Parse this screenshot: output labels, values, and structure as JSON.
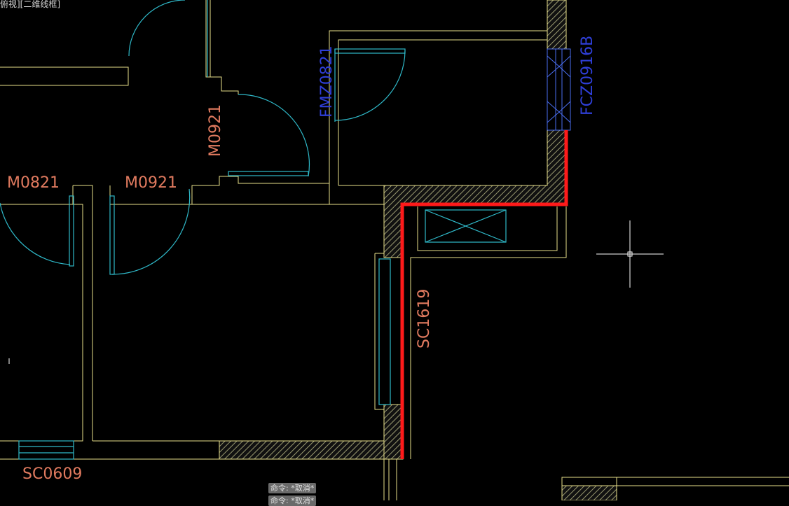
{
  "viewport": {
    "label": "俯视][二维线框]"
  },
  "drawing": {
    "labels": {
      "m0821": "M0821",
      "m0921_left": "M0921",
      "m0921_vertical": "M0921",
      "fm0821": "FMZ0821",
      "fc0916": "FCZ0916B",
      "sc1619": "SC1619",
      "sc0609": "SC0609"
    },
    "colors": {
      "background": "#000000",
      "wall_line": "#e8e08a",
      "door_arc": "#2fb9c9",
      "door_label": "#e07a5f",
      "fire_label": "#2f3fd8",
      "highlight": "#ff1a1a",
      "hatch": "#a8a878"
    }
  },
  "command_history": [
    {
      "prompt": "命令:",
      "value": "*取消*"
    },
    {
      "prompt": "命令:",
      "value": "*取消*"
    }
  ],
  "command": {
    "line1": "命令: *取消*",
    "line2": "命令: *取消*"
  }
}
